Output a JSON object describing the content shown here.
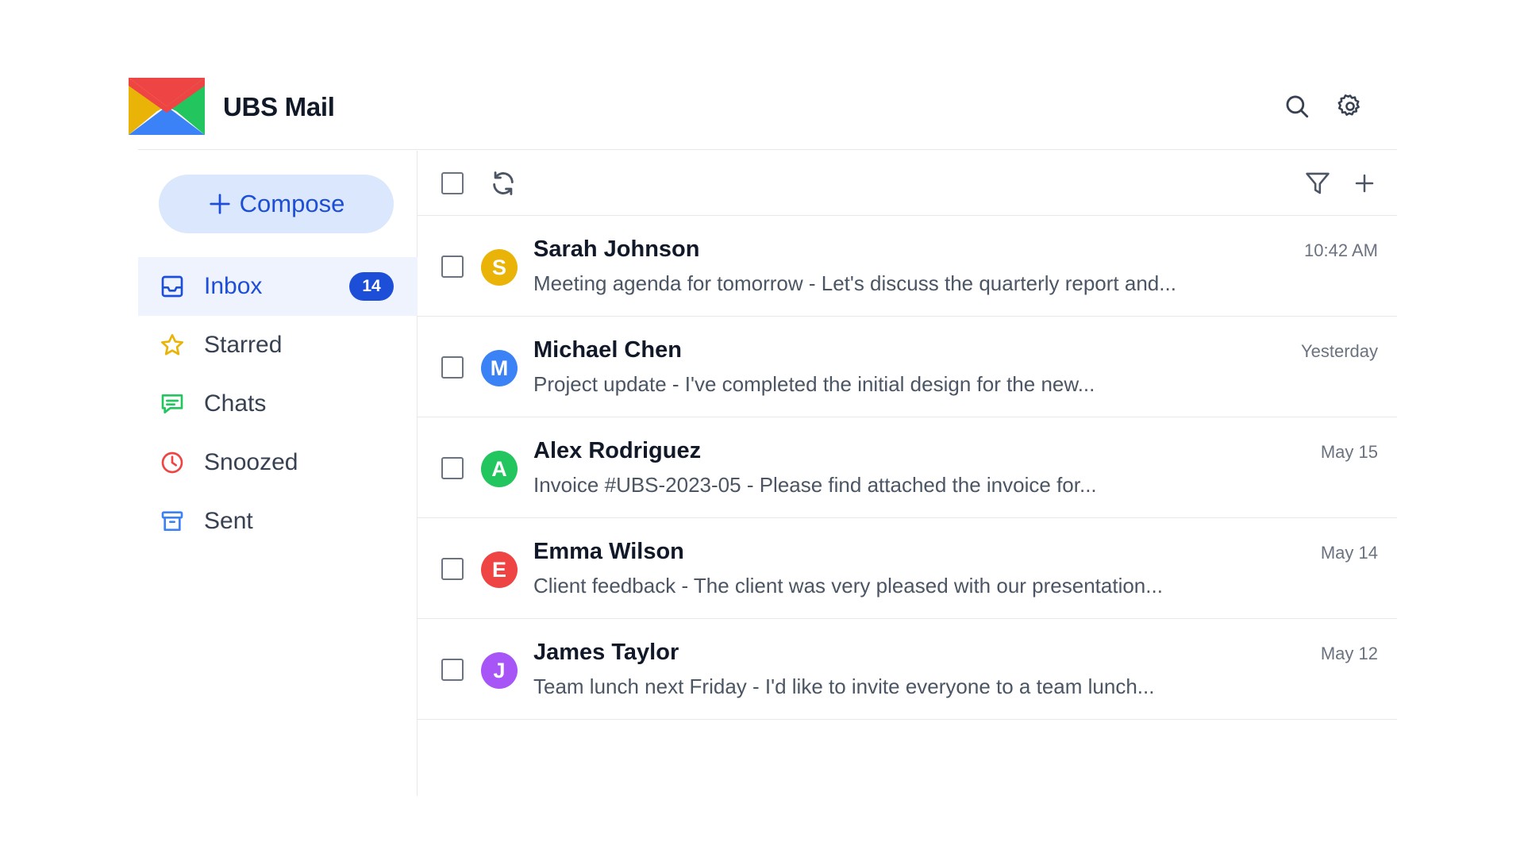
{
  "app": {
    "title": "UBS Mail",
    "icons": {
      "search": "search-icon",
      "settings": "gear-icon"
    }
  },
  "sidebar": {
    "compose_label": "Compose",
    "items": [
      {
        "label": "Inbox",
        "icon": "inbox-icon",
        "badge": "14",
        "active": true,
        "color": "#1d4ed8"
      },
      {
        "label": "Starred",
        "icon": "star-icon",
        "color": "#eab308"
      },
      {
        "label": "Chats",
        "icon": "chat-icon",
        "color": "#22c55e"
      },
      {
        "label": "Snoozed",
        "icon": "clock-icon",
        "color": "#ef4444"
      },
      {
        "label": "Sent",
        "icon": "archive-icon",
        "color": "#3b82f6"
      }
    ]
  },
  "toolbar": {
    "icons": [
      "select-all-checkbox",
      "refresh-icon",
      "filter-icon",
      "plus-icon"
    ]
  },
  "emails": [
    {
      "initial": "S",
      "avatar_color": "#eab308",
      "sender": "Sarah Johnson",
      "snippet": "Meeting agenda for tomorrow - Let's discuss the quarterly report and...",
      "time": "10:42 AM"
    },
    {
      "initial": "M",
      "avatar_color": "#3b82f6",
      "sender": "Michael Chen",
      "snippet": "Project update - I've completed the initial design for the new...",
      "time": "Yesterday"
    },
    {
      "initial": "A",
      "avatar_color": "#22c55e",
      "sender": "Alex Rodriguez",
      "snippet": "Invoice #UBS-2023-05 - Please find attached the invoice for...",
      "time": "May 15"
    },
    {
      "initial": "E",
      "avatar_color": "#ef4444",
      "sender": "Emma Wilson",
      "snippet": "Client feedback - The client was very pleased with our presentation...",
      "time": "May 14"
    },
    {
      "initial": "J",
      "avatar_color": "#a855f7",
      "sender": "James Taylor",
      "snippet": "Team lunch next Friday - I'd like to invite everyone to a team lunch...",
      "time": "May 12"
    }
  ]
}
